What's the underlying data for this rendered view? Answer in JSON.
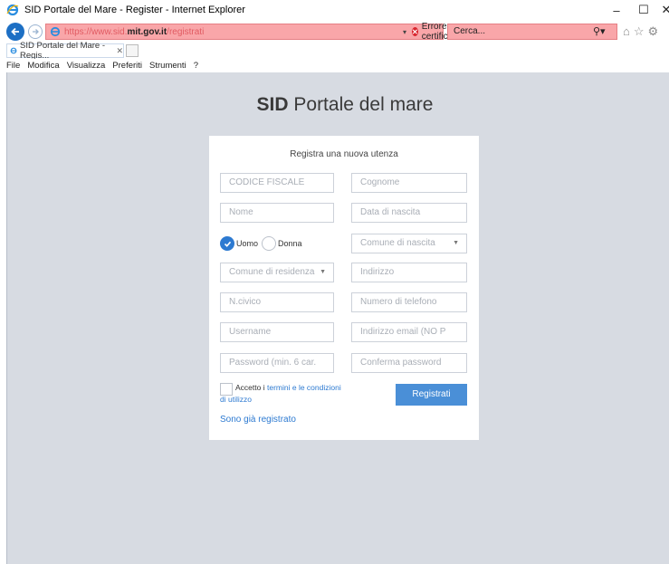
{
  "browser": {
    "window_title": "SID Portale del Mare - Register - Internet Explorer",
    "url_prefix": "https://www.sid.",
    "url_domain": "mit.gov.it",
    "url_path": "/registrati",
    "cert_error": "Errore certificato",
    "search_placeholder": "Cerca...",
    "tab_label": "SID Portale del Mare - Regis...",
    "menu": [
      "File",
      "Modifica",
      "Visualizza",
      "Preferiti",
      "Strumenti",
      "?"
    ],
    "window_controls": {
      "minimize": "–",
      "maximize": "☐",
      "close": "✕"
    }
  },
  "page": {
    "title_bold": "SID",
    "title_rest": " Portale del mare",
    "form_title": "Registra una nuova utenza",
    "fields": {
      "codice_fiscale": "CODICE FISCALE",
      "cognome": "Cognome",
      "nome": "Nome",
      "data_nascita": "Data di nascita",
      "comune_nascita": "Comune di nascita",
      "comune_residenza": "Comune di residenza",
      "indirizzo": "Indirizzo",
      "civico": "N.civico",
      "telefono": "Numero di telefono",
      "username": "Username",
      "email": "Indirizzo email (NO P",
      "password": "Password (min. 6 car.",
      "conferma_password": "Conferma password"
    },
    "gender": {
      "male": "Uomo",
      "female": "Donna",
      "selected": "Uomo"
    },
    "terms_prefix": "Accetto i",
    "terms_link_1": "termini e le condizioni",
    "terms_link_2": "di utilizzo",
    "register_button": "Registrati",
    "already_registered": "Sono già registrato"
  },
  "colors": {
    "accent": "#4a8fd7",
    "page_bg": "#d7dbe2",
    "cert_error_bar": "#f9a6a9"
  }
}
